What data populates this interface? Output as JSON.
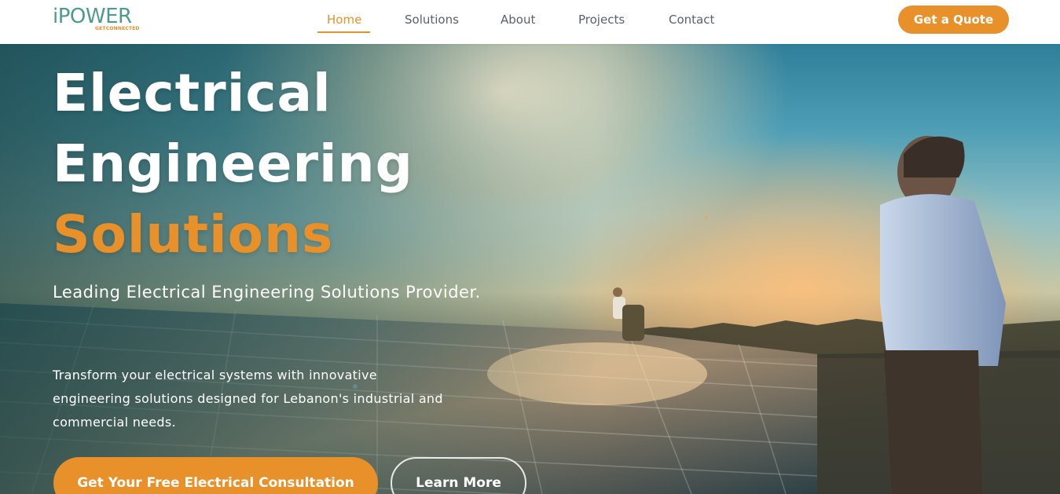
{
  "brand": {
    "name": "iPOWER",
    "tagline": "GETCONNECTED",
    "primary_color": "#e8902a",
    "logo_color": "#4f9a8e"
  },
  "nav": {
    "items": [
      {
        "label": "Home",
        "active": true
      },
      {
        "label": "Solutions",
        "active": false
      },
      {
        "label": "About",
        "active": false
      },
      {
        "label": "Projects",
        "active": false
      },
      {
        "label": "Contact",
        "active": false
      }
    ],
    "cta_label": "Get a Quote"
  },
  "hero": {
    "title_line1": "Electrical",
    "title_line2": "Engineering",
    "title_line3": "Solutions",
    "subtitle": "Leading Electrical Engineering Solutions Provider.",
    "description": "Transform your electrical systems with innovative engineering solutions designed for Lebanon's industrial and commercial needs.",
    "primary_cta": "Get Your Free Electrical Consultation",
    "secondary_cta": "Learn More",
    "background_image": "solar-panel-field-sunset-photo"
  }
}
